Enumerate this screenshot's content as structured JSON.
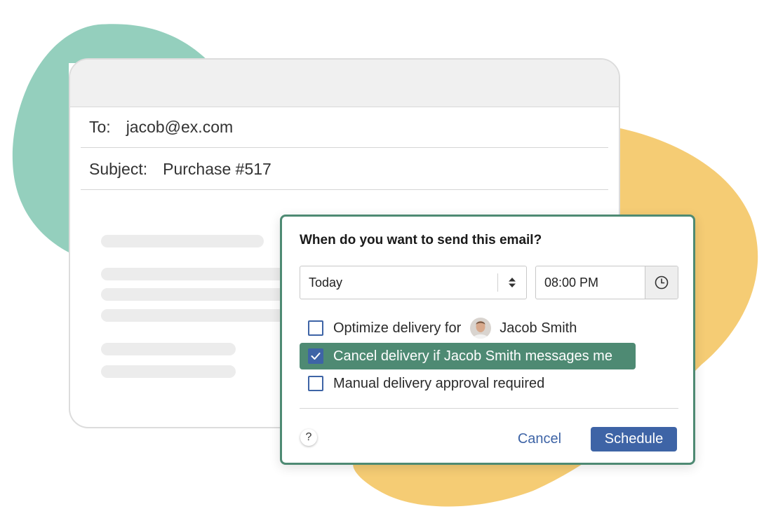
{
  "colors": {
    "green_blob": "#94cfbd",
    "yellow_blob": "#f5cc74",
    "dialog_border": "#4e8a73",
    "highlight": "#4e8a73",
    "primary": "#3e64a6"
  },
  "email": {
    "to_label": "To:",
    "to_value": "jacob@ex.com",
    "subject_label": "Subject:",
    "subject_value": "Purchase #517"
  },
  "dialog": {
    "title": "When do you want to send this email?",
    "day_select": {
      "value": "Today",
      "icon": "up-down-arrows-icon"
    },
    "time_input": {
      "value": "08:00 PM",
      "icon": "clock-icon"
    },
    "options": [
      {
        "label": "Optimize delivery for",
        "checked": false,
        "contact": "Jacob Smith"
      },
      {
        "label": "Cancel delivery if Jacob Smith messages me",
        "checked": true
      },
      {
        "label": "Manual delivery approval required",
        "checked": false
      }
    ],
    "help_label": "?",
    "cancel_label": "Cancel",
    "schedule_label": "Schedule"
  }
}
